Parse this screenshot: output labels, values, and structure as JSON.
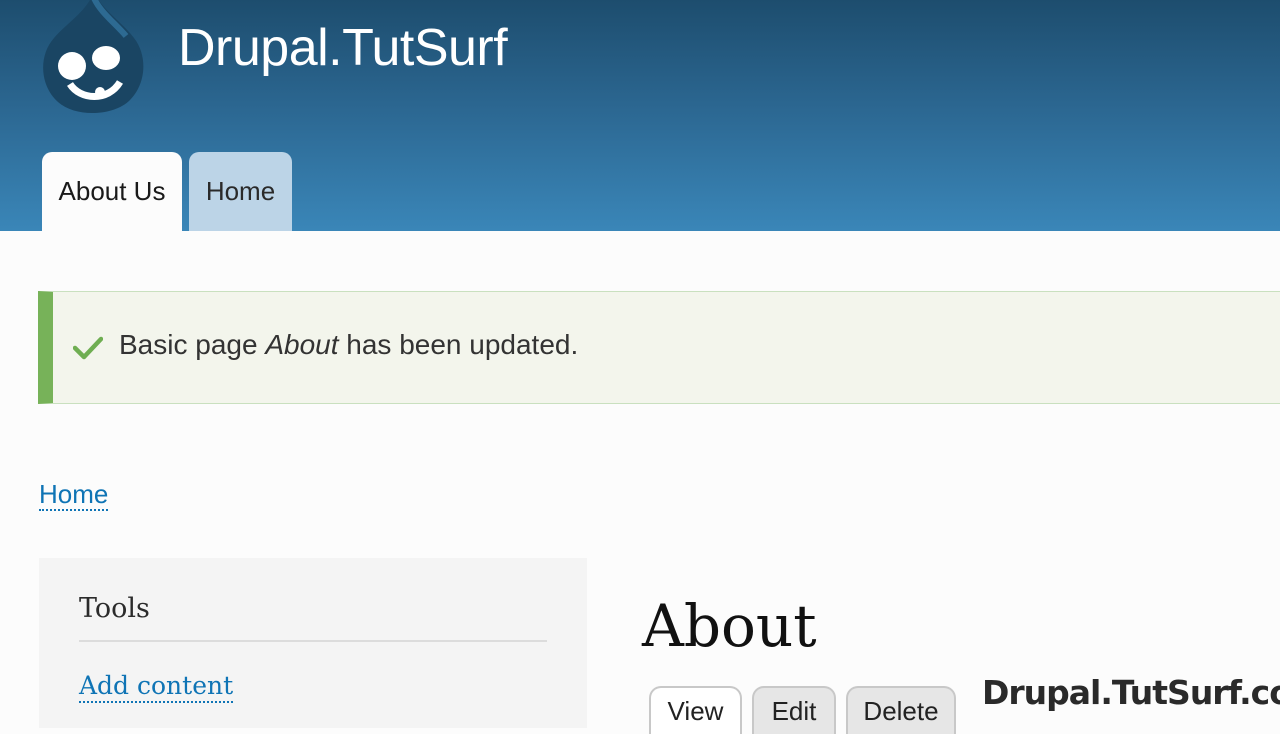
{
  "header": {
    "site_name": "Drupal.TutSurf",
    "logo_icon": "drupal-drop-icon",
    "tabs": [
      {
        "label": "About Us",
        "active": true
      },
      {
        "label": "Home",
        "active": false
      }
    ]
  },
  "status": {
    "icon": "checkmark-icon",
    "prefix": "Basic page ",
    "title": "About",
    "suffix": " has been updated."
  },
  "breadcrumb": {
    "home": "Home"
  },
  "sidebar": {
    "title": "Tools",
    "link": "Add content"
  },
  "main": {
    "title": "About",
    "tabs": [
      "View",
      "Edit",
      "Delete"
    ]
  },
  "watermark": "Drupal.TutSurf.com",
  "colors": {
    "header_top": "#1d4d6e",
    "header_bottom": "#3a86b8",
    "status_accent": "#77b259",
    "link": "#0f74b5"
  }
}
